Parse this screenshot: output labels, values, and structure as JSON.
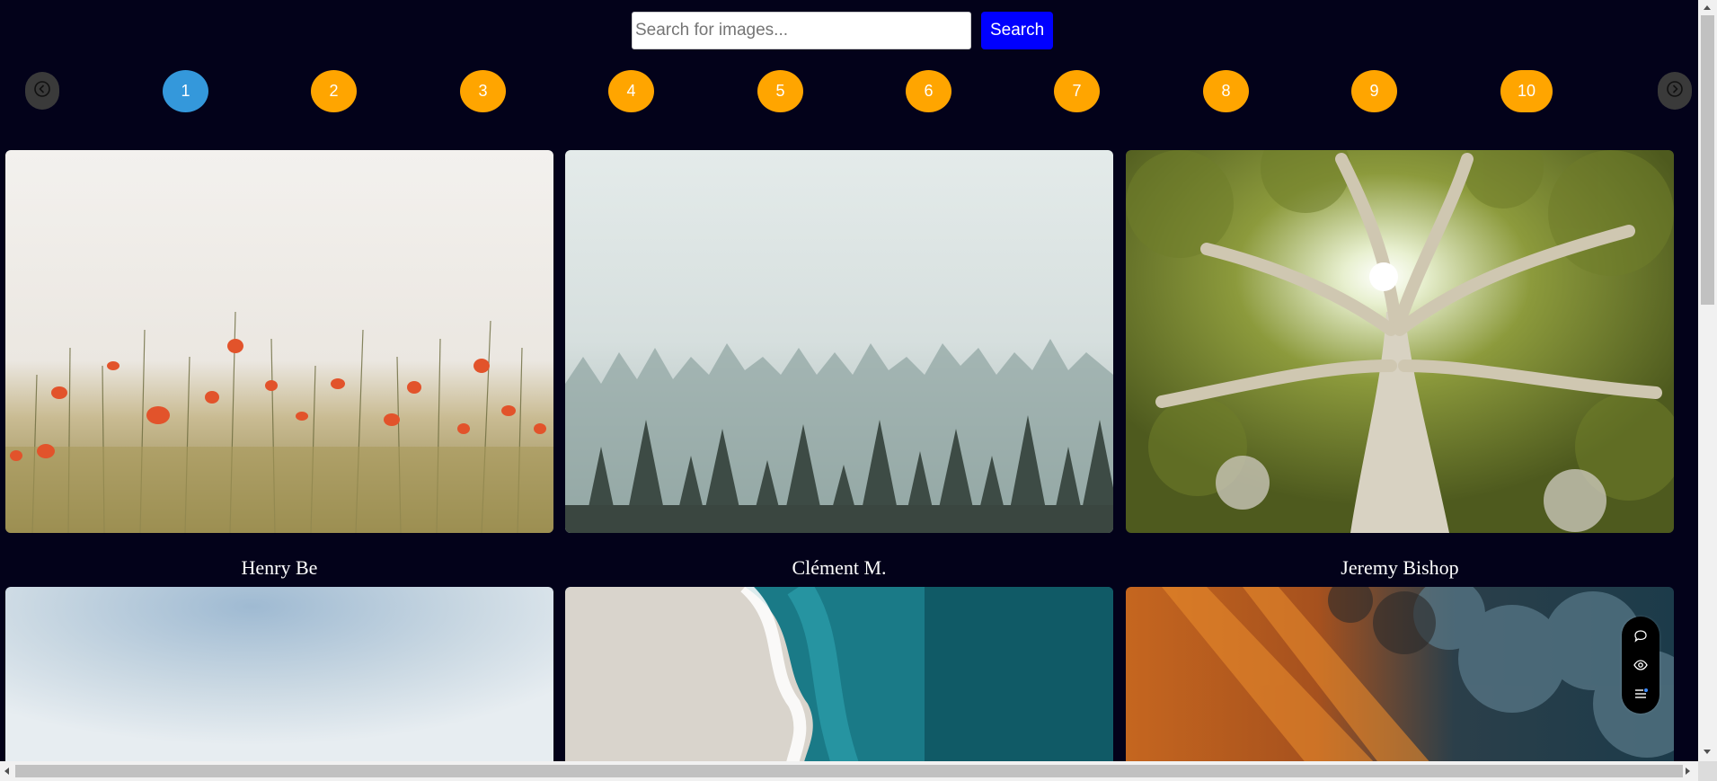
{
  "search": {
    "placeholder": "Search for images...",
    "value": "",
    "button_label": "Search"
  },
  "pagination": {
    "prev_icon": "circle-arrow-left-icon",
    "next_icon": "circle-arrow-right-icon",
    "active_page": "1",
    "pages": [
      "1",
      "2",
      "3",
      "4",
      "5",
      "6",
      "7",
      "8",
      "9",
      "10"
    ],
    "active_color": "#3498db",
    "page_color": "#ffa500"
  },
  "gallery": {
    "photos": [
      {
        "caption": "Henry Be",
        "subject": "poppy-field"
      },
      {
        "caption": "Clément M.",
        "subject": "foggy-forest"
      },
      {
        "caption": "Jeremy Bishop",
        "subject": "sunlit-tree"
      },
      {
        "caption": "",
        "subject": "blurred-sky"
      },
      {
        "caption": "",
        "subject": "aerial-ocean-shore"
      },
      {
        "caption": "",
        "subject": "sunset-clouds"
      }
    ]
  },
  "floating_widget": {
    "icons": [
      "chat-bubble-icon",
      "eye-icon",
      "list-icon"
    ]
  },
  "colors": {
    "background": "#03021a",
    "search_button": "#0000ff"
  }
}
